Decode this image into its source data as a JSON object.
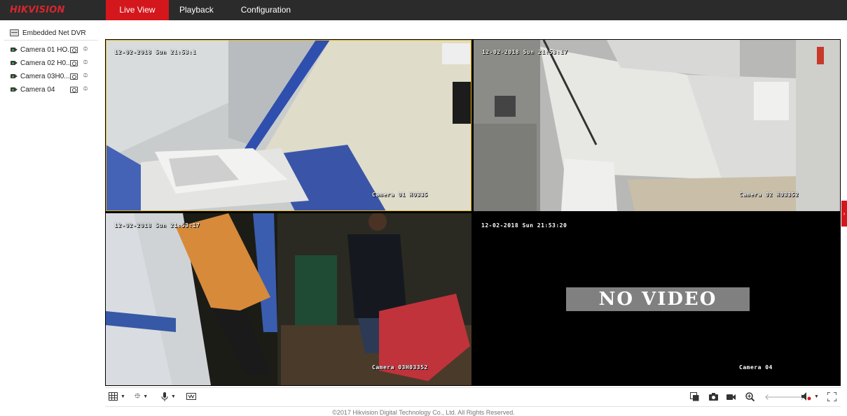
{
  "brand": {
    "logo_text": "HIKVISION",
    "accent": "#d4161d"
  },
  "nav": {
    "items": [
      {
        "label": "Live View",
        "active": true
      },
      {
        "label": "Playback",
        "active": false
      },
      {
        "label": "Configuration",
        "active": false
      }
    ]
  },
  "sidebar": {
    "device_label": "Embedded Net DVR",
    "cameras": [
      {
        "label": "Camera 01 HO..."
      },
      {
        "label": "Camera 02 H0..."
      },
      {
        "label": "Camera 03H0..."
      },
      {
        "label": "Camera 04"
      }
    ]
  },
  "panes": [
    {
      "timestamp": "12-02-2018 Sun 21:53:1",
      "camera_name": "Camera 01  H0335",
      "selected": true
    },
    {
      "timestamp": "12-02-2018 Sun 21:53:17",
      "camera_name": "Camera 02 H03352",
      "selected": false
    },
    {
      "timestamp": "12-02-2018 Sun 21:53:17",
      "camera_name": "Camera 03H03352",
      "selected": false
    },
    {
      "timestamp": "12-02-2018 Sun 21:53:20",
      "camera_name": "Camera 04",
      "no_video_text": "NO VIDEO",
      "selected": false
    }
  ],
  "toolbar": {
    "left": [
      "window-layout-icon",
      "ptz-icon",
      "microphone-icon",
      "stream-icon"
    ],
    "right": [
      "stop-all-icon",
      "capture-icon",
      "record-icon",
      "zoom-icon",
      "previous-page-icon",
      "next-page-icon",
      "volume-icon",
      "fullscreen-icon"
    ]
  },
  "footer": {
    "text": "©2017 Hikvision Digital Technology Co., Ltd. All Rights Reserved."
  }
}
